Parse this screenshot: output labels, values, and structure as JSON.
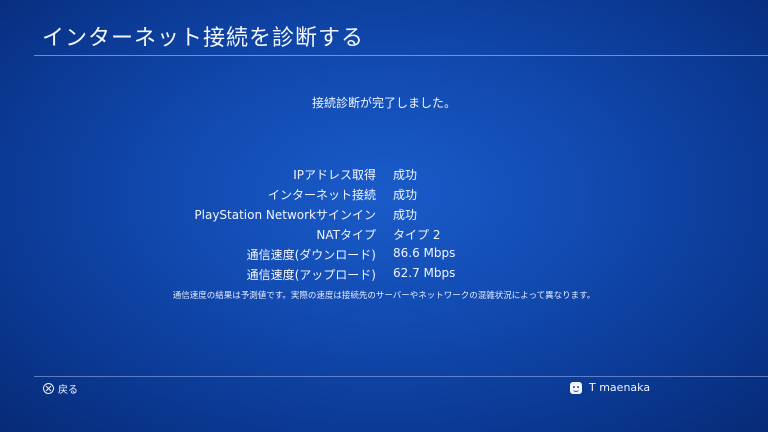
{
  "header": {
    "title": "インターネット接続を診断する"
  },
  "main": {
    "message": "接続診断が完了しました。",
    "results": [
      {
        "label": "IPアドレス取得",
        "value": "成功"
      },
      {
        "label": "インターネット接続",
        "value": "成功"
      },
      {
        "label": "PlayStation Networkサインイン",
        "value": "成功"
      },
      {
        "label": "NATタイプ",
        "value": "タイプ 2"
      },
      {
        "label": "通信速度(ダウンロード)",
        "value": "86.6 Mbps"
      },
      {
        "label": "通信速度(アップロード)",
        "value": "62.7 Mbps"
      }
    ],
    "note": "通信速度の結果は予測値です。実際の速度は接続先のサーバーやネットワークの混雑状況によって異なります。"
  },
  "footer": {
    "back_icon": "cross-button-icon",
    "back_label": "戻る",
    "user_icon": "avatar-icon",
    "user_name": "T maenaka"
  }
}
